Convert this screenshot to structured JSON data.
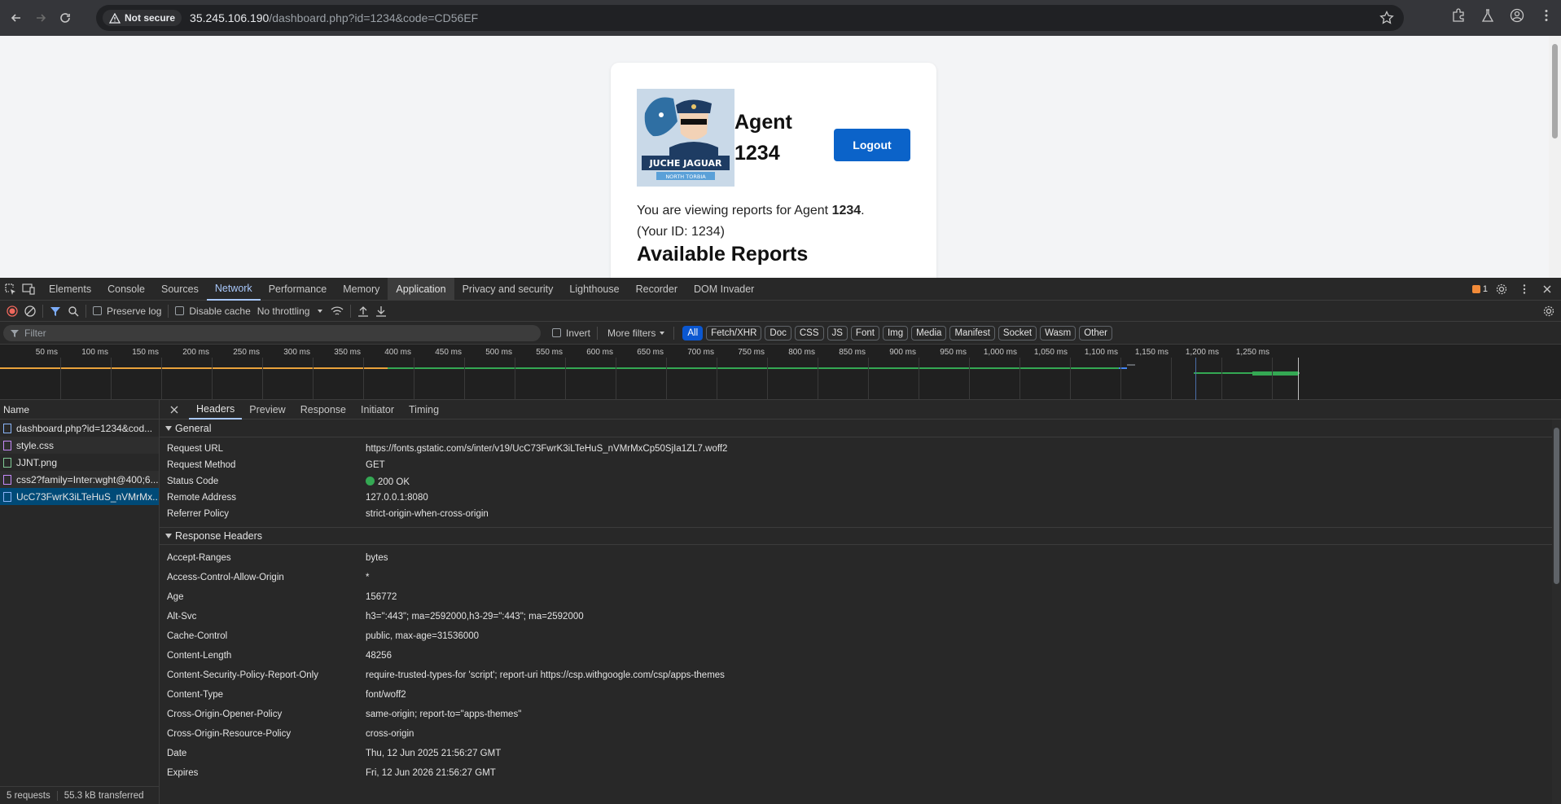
{
  "browser": {
    "security_label": "Not secure",
    "url_host": "35.245.106.190",
    "url_path": "/dashboard.php?id=1234&code=CD56EF"
  },
  "page": {
    "agent_label": "Agent 1234",
    "logout_label": "Logout",
    "viewing_prefix": "You are viewing reports for Agent ",
    "viewing_agent": "1234",
    "viewing_suffix": ".",
    "your_id": "(Your ID: 1234)",
    "available_reports": "Available Reports",
    "logo_title": "JUCHE JAGUAR",
    "logo_subtitle": "NORTH TORBIA"
  },
  "devtools": {
    "tabs": [
      "Elements",
      "Console",
      "Sources",
      "Network",
      "Performance",
      "Memory",
      "Application",
      "Privacy and security",
      "Lighthouse",
      "Recorder",
      "DOM Invader"
    ],
    "active_tab": "Network",
    "issues_count": "1",
    "toolbar": {
      "preserve_log": "Preserve log",
      "disable_cache": "Disable cache",
      "throttling": "No throttling"
    },
    "filter": {
      "placeholder": "Filter",
      "invert": "Invert",
      "more_filters": "More filters",
      "chips": [
        "All",
        "Fetch/XHR",
        "Doc",
        "CSS",
        "JS",
        "Font",
        "Img",
        "Media",
        "Manifest",
        "Socket",
        "Wasm",
        "Other"
      ]
    },
    "timeline_ticks": [
      "50 ms",
      "100 ms",
      "150 ms",
      "200 ms",
      "250 ms",
      "300 ms",
      "350 ms",
      "400 ms",
      "450 ms",
      "500 ms",
      "550 ms",
      "600 ms",
      "650 ms",
      "700 ms",
      "750 ms",
      "800 ms",
      "850 ms",
      "900 ms",
      "950 ms",
      "1,000 ms",
      "1,050 ms",
      "1,100 ms",
      "1,150 ms",
      "1,200 ms",
      "1,250 ms"
    ],
    "requests_header": "Name",
    "requests": [
      "dashboard.php?id=1234&cod...",
      "style.css",
      "JJNT.png",
      "css2?family=Inter:wght@400;6...",
      "UcC73FwrK3iLTeHuS_nVMrMx..."
    ],
    "status": {
      "requests": "5 requests",
      "transferred": "55.3 kB transferred"
    },
    "detail_tabs": [
      "Headers",
      "Preview",
      "Response",
      "Initiator",
      "Timing"
    ],
    "general_title": "General",
    "general": [
      {
        "k": "Request URL",
        "v": "https://fonts.gstatic.com/s/inter/v19/UcC73FwrK3iLTeHuS_nVMrMxCp50SjIa1ZL7.woff2"
      },
      {
        "k": "Request Method",
        "v": "GET"
      },
      {
        "k": "Status Code",
        "v": "200 OK"
      },
      {
        "k": "Remote Address",
        "v": "127.0.0.1:8080"
      },
      {
        "k": "Referrer Policy",
        "v": "strict-origin-when-cross-origin"
      }
    ],
    "response_title": "Response Headers",
    "response_headers": [
      {
        "k": "Accept-Ranges",
        "v": "bytes"
      },
      {
        "k": "Access-Control-Allow-Origin",
        "v": "*"
      },
      {
        "k": "Age",
        "v": "156772"
      },
      {
        "k": "Alt-Svc",
        "v": "h3=\":443\"; ma=2592000,h3-29=\":443\"; ma=2592000"
      },
      {
        "k": "Cache-Control",
        "v": "public, max-age=31536000"
      },
      {
        "k": "Content-Length",
        "v": "48256"
      },
      {
        "k": "Content-Security-Policy-Report-Only",
        "v": "require-trusted-types-for 'script'; report-uri https://csp.withgoogle.com/csp/apps-themes"
      },
      {
        "k": "Content-Type",
        "v": "font/woff2"
      },
      {
        "k": "Cross-Origin-Opener-Policy",
        "v": "same-origin; report-to=\"apps-themes\""
      },
      {
        "k": "Cross-Origin-Resource-Policy",
        "v": "cross-origin"
      },
      {
        "k": "Date",
        "v": "Thu, 12 Jun 2025 21:56:27 GMT"
      },
      {
        "k": "Expires",
        "v": "Fri, 12 Jun 2026 21:56:27 GMT"
      }
    ]
  }
}
